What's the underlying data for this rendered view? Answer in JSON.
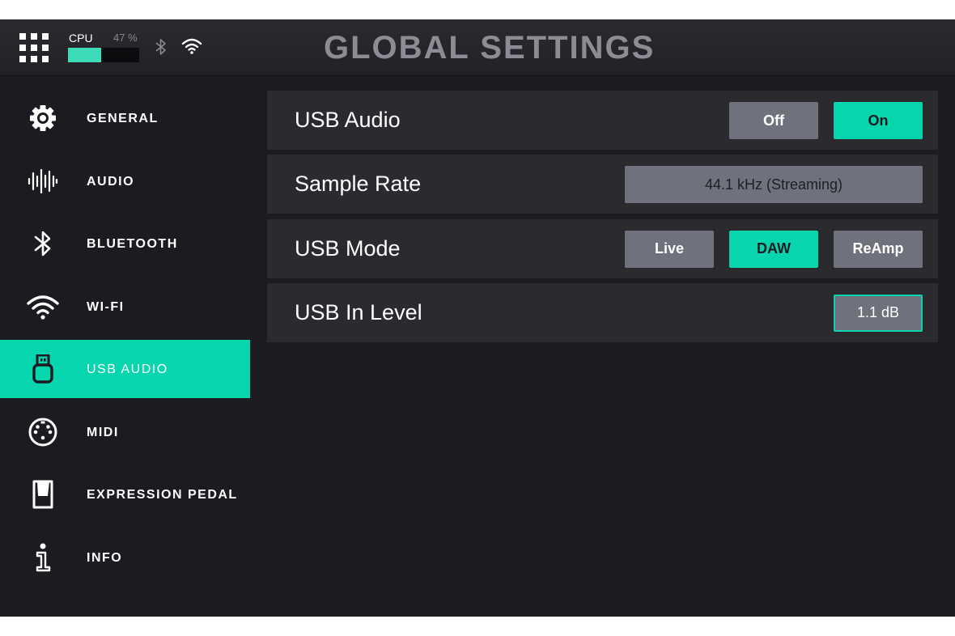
{
  "header": {
    "title": "GLOBAL SETTINGS",
    "cpu_label": "CPU",
    "cpu_value": "47 %",
    "cpu_usage_fraction": 0.47,
    "accent_color": "#06d5ad"
  },
  "sidebar": {
    "items": [
      {
        "label": "GENERAL",
        "icon": "gear-icon"
      },
      {
        "label": "AUDIO",
        "icon": "waveform-icon"
      },
      {
        "label": "BLUETOOTH",
        "icon": "bluetooth-icon"
      },
      {
        "label": "WI-FI",
        "icon": "wifi-icon"
      },
      {
        "label": "USB AUDIO",
        "icon": "usb-icon",
        "active": true
      },
      {
        "label": "MIDI",
        "icon": "midi-connector-icon"
      },
      {
        "label": "EXPRESSION PEDAL",
        "icon": "expression-pedal-icon"
      },
      {
        "label": "INFO",
        "icon": "info-icon"
      }
    ]
  },
  "settings": {
    "usb_audio": {
      "label": "USB Audio",
      "off": "Off",
      "on": "On",
      "selected": "On"
    },
    "sample_rate": {
      "label": "Sample Rate",
      "value": "44.1 kHz (Streaming)"
    },
    "usb_mode": {
      "label": "USB Mode",
      "options": [
        "Live",
        "DAW",
        "ReAmp"
      ],
      "selected": "DAW"
    },
    "usb_in_level": {
      "label": "USB In Level",
      "value": "1.1 dB"
    }
  }
}
